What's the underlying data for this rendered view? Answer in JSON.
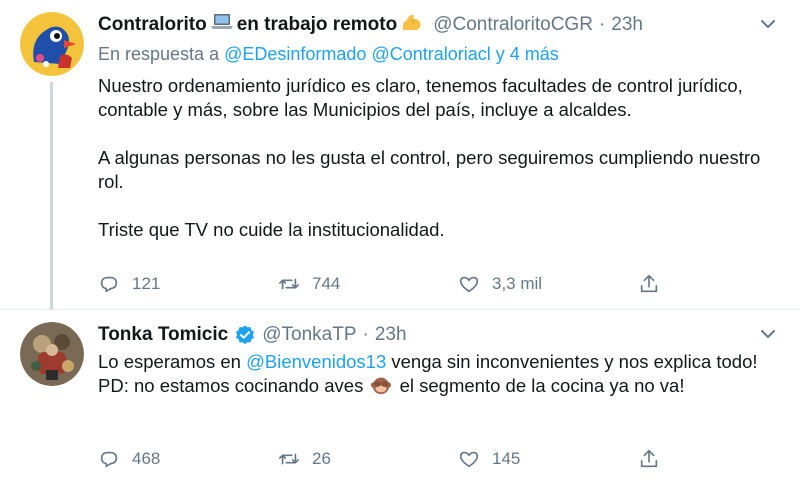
{
  "tweets": [
    {
      "display_name": "Contralorito",
      "name_suffix": "en trabajo remoto",
      "emoji_1": "laptop-emoji",
      "emoji_2": "flexed-biceps-emoji",
      "handle": "@ContraloritoCGR",
      "separator": "·",
      "time": "23h",
      "reply_prefix": "En respuesta a",
      "reply_mentions": [
        "@EDesinformado",
        "@Contraloriacl"
      ],
      "reply_suffix": "y 4 más",
      "paragraphs": [
        "Nuestro ordenamiento jurídico es claro, tenemos facultades de control jurídico, contable y más, sobre las Municipios del país, incluye a alcaldes.",
        "A algunas personas no les gusta el control, pero seguiremos cumpliendo nuestro rol.",
        "Triste que TV no cuide la institucionalidad."
      ],
      "stats": {
        "replies": "121",
        "retweets": "744",
        "likes": "3,3 mil"
      }
    },
    {
      "display_name": "Tonka Tomicic",
      "verified": true,
      "handle": "@TonkaTP",
      "separator": "·",
      "time": "23h",
      "text_1": "Lo esperamos en ",
      "mention": "@Bienvenidos13",
      "text_2": " venga sin inconvenientes y nos explica todo!       PD: no estamos cocinando aves ",
      "emoji": "see-no-evil-monkey-emoji",
      "text_3": " el segmento de la cocina ya no va!",
      "stats": {
        "replies": "468",
        "retweets": "26",
        "likes": "145"
      }
    }
  ],
  "colors": {
    "text": "#14171a",
    "secondary": "#657786",
    "link": "#1da1f2",
    "border": "#e1e8ed",
    "thread_line": "#ccd6dd"
  }
}
